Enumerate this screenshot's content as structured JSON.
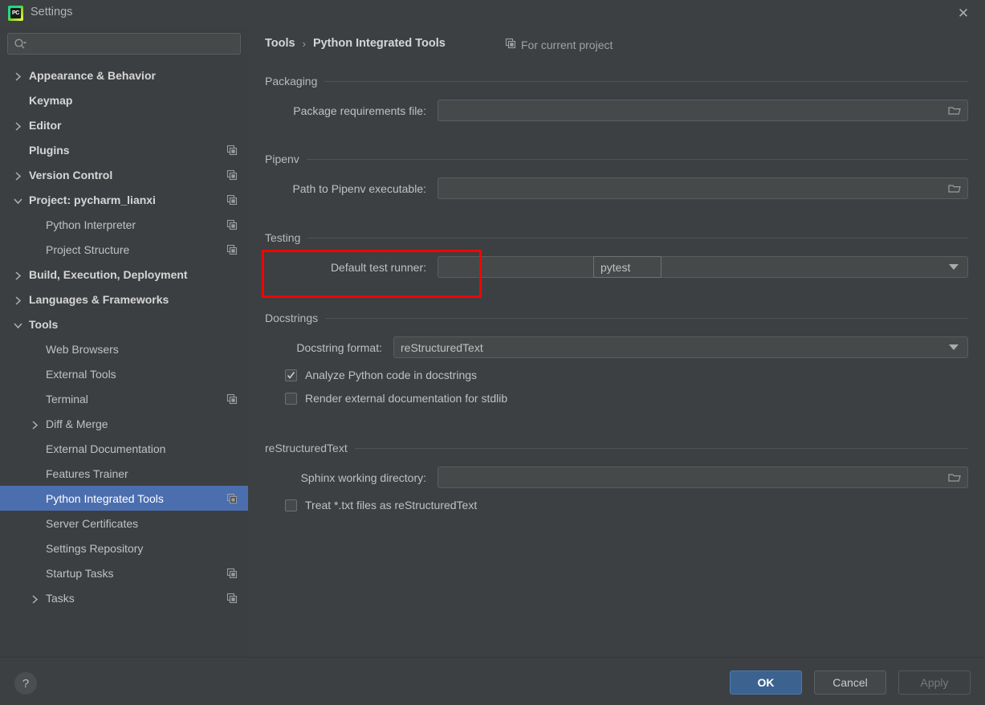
{
  "window": {
    "title": "Settings",
    "logo_text": "PC",
    "logo_icon": "pycharm-logo-icon",
    "close_icon": "close-icon"
  },
  "search": {
    "value": "",
    "placeholder": "",
    "icon": "search-icon"
  },
  "sidebar": {
    "items": [
      {
        "label": "Appearance & Behavior",
        "level": 0,
        "arrow": "chevron-right-icon",
        "config_icon": false,
        "selected": false,
        "bold": true
      },
      {
        "label": "Keymap",
        "level": 0,
        "arrow": "",
        "config_icon": false,
        "selected": false,
        "bold": true
      },
      {
        "label": "Editor",
        "level": 0,
        "arrow": "chevron-right-icon",
        "config_icon": false,
        "selected": false,
        "bold": true
      },
      {
        "label": "Plugins",
        "level": 0,
        "arrow": "",
        "config_icon": true,
        "selected": false,
        "bold": true
      },
      {
        "label": "Version Control",
        "level": 0,
        "arrow": "chevron-right-icon",
        "config_icon": true,
        "selected": false,
        "bold": true
      },
      {
        "label": "Project: pycharm_lianxi",
        "level": 0,
        "arrow": "chevron-down-icon",
        "config_icon": true,
        "selected": false,
        "bold": true
      },
      {
        "label": "Python Interpreter",
        "level": 1,
        "arrow": "",
        "config_icon": true,
        "selected": false,
        "bold": false
      },
      {
        "label": "Project Structure",
        "level": 1,
        "arrow": "",
        "config_icon": true,
        "selected": false,
        "bold": false
      },
      {
        "label": "Build, Execution, Deployment",
        "level": 0,
        "arrow": "chevron-right-icon",
        "config_icon": false,
        "selected": false,
        "bold": true
      },
      {
        "label": "Languages & Frameworks",
        "level": 0,
        "arrow": "chevron-right-icon",
        "config_icon": false,
        "selected": false,
        "bold": true
      },
      {
        "label": "Tools",
        "level": 0,
        "arrow": "chevron-down-icon",
        "config_icon": false,
        "selected": false,
        "bold": true
      },
      {
        "label": "Web Browsers",
        "level": 1,
        "arrow": "",
        "config_icon": false,
        "selected": false,
        "bold": false
      },
      {
        "label": "External Tools",
        "level": 1,
        "arrow": "",
        "config_icon": false,
        "selected": false,
        "bold": false
      },
      {
        "label": "Terminal",
        "level": 1,
        "arrow": "",
        "config_icon": true,
        "selected": false,
        "bold": false
      },
      {
        "label": "Diff & Merge",
        "level": 1,
        "arrow": "chevron-right-icon",
        "config_icon": false,
        "selected": false,
        "bold": false
      },
      {
        "label": "External Documentation",
        "level": 1,
        "arrow": "",
        "config_icon": false,
        "selected": false,
        "bold": false
      },
      {
        "label": "Features Trainer",
        "level": 1,
        "arrow": "",
        "config_icon": false,
        "selected": false,
        "bold": false
      },
      {
        "label": "Python Integrated Tools",
        "level": 1,
        "arrow": "",
        "config_icon": true,
        "selected": true,
        "bold": false
      },
      {
        "label": "Server Certificates",
        "level": 1,
        "arrow": "",
        "config_icon": false,
        "selected": false,
        "bold": false
      },
      {
        "label": "Settings Repository",
        "level": 1,
        "arrow": "",
        "config_icon": false,
        "selected": false,
        "bold": false
      },
      {
        "label": "Startup Tasks",
        "level": 1,
        "arrow": "",
        "config_icon": true,
        "selected": false,
        "bold": false
      },
      {
        "label": "Tasks",
        "level": 1,
        "arrow": "chevron-right-icon",
        "config_icon": true,
        "selected": false,
        "bold": false
      }
    ]
  },
  "breadcrumb": {
    "parent": "Tools",
    "separator": "›",
    "current": "Python Integrated Tools",
    "scope_label": "For current project",
    "scope_icon": "project-config-icon"
  },
  "sections": {
    "packaging": {
      "title": "Packaging",
      "requirements_label": "Package requirements file:",
      "requirements_value": "",
      "browse_icon": "folder-icon"
    },
    "pipenv": {
      "title": "Pipenv",
      "path_label": "Path to Pipenv executable:",
      "path_value": "",
      "browse_icon": "folder-icon"
    },
    "testing": {
      "title": "Testing",
      "runner_label": "Default test runner:",
      "runner_value": "pytest",
      "dropdown_icon": "chevron-down-icon"
    },
    "docstrings": {
      "title": "Docstrings",
      "format_label": "Docstring format:",
      "format_value": "reStructuredText",
      "dropdown_icon": "chevron-down-icon",
      "analyze_label": "Analyze Python code in docstrings",
      "analyze_checked": true,
      "render_label": "Render external documentation for stdlib",
      "render_checked": false
    },
    "restructuredtext": {
      "title": "reStructuredText",
      "sphinx_label": "Sphinx working directory:",
      "sphinx_value": "",
      "browse_icon": "folder-icon",
      "treat_txt_label": "Treat *.txt files as reStructuredText",
      "treat_txt_checked": false
    }
  },
  "footer": {
    "help_label": "?",
    "ok_label": "OK",
    "cancel_label": "Cancel",
    "apply_label": "Apply"
  },
  "annotation": {
    "color": "#fe0000",
    "target": "default-test-runner-row"
  },
  "colors": {
    "accent_selection": "#4b6eaf",
    "sidebar_bg": "#3c3f41",
    "panel_bg": "#3c4043",
    "ok_button": "#3c628f",
    "annotation_red": "#fe0000"
  }
}
